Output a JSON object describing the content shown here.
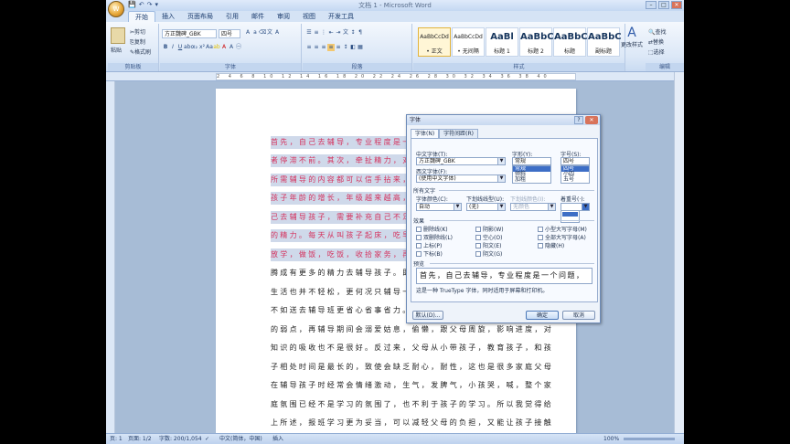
{
  "window": {
    "title": "文档 1 - Microsoft Word"
  },
  "quick_access": [
    "💾",
    "↶",
    "↷",
    "▾"
  ],
  "tabs": [
    "开始",
    "插入",
    "页面布局",
    "引用",
    "邮件",
    "审阅",
    "视图",
    "开发工具"
  ],
  "ribbon": {
    "clipboard": {
      "paste": "粘贴",
      "cut": "剪切",
      "copy": "复制",
      "format_painter": "格式刷",
      "label": "剪贴板"
    },
    "font": {
      "name": "方正魏碑_GBK",
      "size": "四号",
      "label": "字体"
    },
    "paragraph": {
      "label": "段落"
    },
    "styles": {
      "label": "样式",
      "items": [
        {
          "preview": "AaBbCcDd",
          "name": "• 正文"
        },
        {
          "preview": "AaBbCcDd",
          "name": "• 无间隔"
        },
        {
          "preview": "AaBl",
          "name": "标题 1"
        },
        {
          "preview": "AaBbC",
          "name": "标题 2"
        },
        {
          "preview": "AaBbC",
          "name": "标题"
        },
        {
          "preview": "AaBbC",
          "name": "副标题"
        }
      ],
      "change_styles": "更改样式"
    },
    "editing": {
      "find": "查找",
      "replace": "替换",
      "select": "选择",
      "label": "编辑"
    }
  },
  "document": {
    "lines": [
      {
        "text": "首先，自己去辅导，专业程度是一个",
        "highlighted": true
      },
      {
        "text": "者停滞不前。其次，牵扯精力，对于",
        "highlighted": true
      },
      {
        "text": "所需辅导的内容都可以信手拈来，不",
        "highlighted": true
      },
      {
        "text": "孩子年龄的增长，年级越来越高，知",
        "highlighted": true
      },
      {
        "text": "己去辅导孩子，需要补充自己不足部",
        "highlighted": true
      },
      {
        "text": "的精力。每天从叫孩子起床，吃早餐",
        "highlighted": true
      },
      {
        "text": "放学，做饭，吃饭，收拾家务，再辅",
        "highlighted": true
      },
      {
        "text": "腾成有更多的精力去辅导孩子。即使",
        "highlighted": false
      },
      {
        "text": "生活也并不轻松，更何况只辅导一个",
        "highlighted": false
      },
      {
        "text": "不如送去辅导班更省心省事省力。再",
        "highlighted": false
      },
      {
        "text": "的弱点，再辅导期间会溺爱姑息，偷懒，跟父母周旋，影响进度，对",
        "highlighted": false
      },
      {
        "text": "知识的吸收也不是很好。反过来，父母从小带孩子，教育孩子，和孩",
        "highlighted": false
      },
      {
        "text": "子相处时间是最长的，致使会缺乏耐心，耐性，这也是很多家庭父母",
        "highlighted": false
      },
      {
        "text": "在辅导孩子时经常会情绪激动，生气，发脾气，小孩哭，喊，整个家",
        "highlighted": false
      },
      {
        "text": "庭氛围已经不是学习的氛围了，也不利于孩子的学习。所以我觉得给",
        "highlighted": false
      },
      {
        "text": "上所述，报班学习更为妥当，可以减轻父母的负担，又能让孩子接触",
        "highlighted": false
      }
    ]
  },
  "status_bar": {
    "page": "页: 1",
    "pages": "页面: 1/2",
    "words": "字数: 200/1,054",
    "lang": "中文(简体，中国)",
    "mode": "插入",
    "zoom": "100%"
  },
  "dialog": {
    "title": "字体",
    "help": "?",
    "close": "✕",
    "tabs": [
      "字体(N)",
      "字符间距(R)"
    ],
    "cn_font_label": "中文字体(T):",
    "cn_font_value": "方正魏碑_GBK",
    "west_font_label": "西文字体(F):",
    "west_font_value": "(使用中文字体)",
    "style_label": "字形(Y):",
    "style_value": "常规",
    "style_options": [
      "常规",
      "倾斜",
      "加粗"
    ],
    "size_label": "字号(S):",
    "size_value": "四号",
    "size_options": [
      "四号",
      "小四",
      "五号"
    ],
    "all_text": "所有文字",
    "color_label": "字体颜色(C):",
    "color_value": "自动",
    "underline_label": "下划线线型(U):",
    "underline_value": "(无)",
    "underline_color_label": "下划线颜色(I):",
    "underline_color_value": "无颜色",
    "emphasis_label": "着重号(·):",
    "effects_label": "效果",
    "effects_col1": [
      "删除线(K)",
      "双删除线(L)",
      "上标(P)",
      "下标(B)"
    ],
    "effects_col2": [
      "阴影(W)",
      "空心(O)",
      "阳文(E)",
      "阴文(G)"
    ],
    "effects_col3": [
      "小型大写字母(M)",
      "全部大写字母(A)",
      "隐藏(H)"
    ],
    "preview_label": "预览",
    "preview_text": "首先，自己去辅导，专业程度是一个问题，",
    "note": "这是一种 TrueType 字体，同时适用于屏幕和打印机。",
    "default_btn": "默认(D)...",
    "ok_btn": "确定",
    "cancel_btn": "取消"
  }
}
